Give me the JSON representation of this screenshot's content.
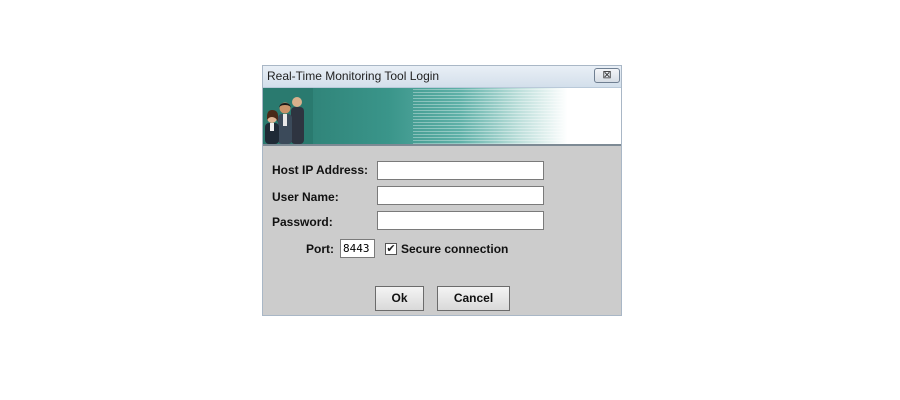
{
  "window": {
    "title": "Real-Time Monitoring Tool Login",
    "close_glyph": "⊠"
  },
  "form": {
    "host_label": "Host IP Address:",
    "host_value": "",
    "user_label": "User Name:",
    "user_value": "",
    "password_label": "Password:",
    "password_value": "",
    "port_label": "Port:",
    "port_value": "8443",
    "secure_label": "Secure connection",
    "secure_checked": true,
    "check_glyph": "✔"
  },
  "buttons": {
    "ok_label": "Ok",
    "cancel_label": "Cancel"
  },
  "colors": {
    "banner_teal": "#2a7a6f",
    "dialog_bg": "#cccccc"
  }
}
